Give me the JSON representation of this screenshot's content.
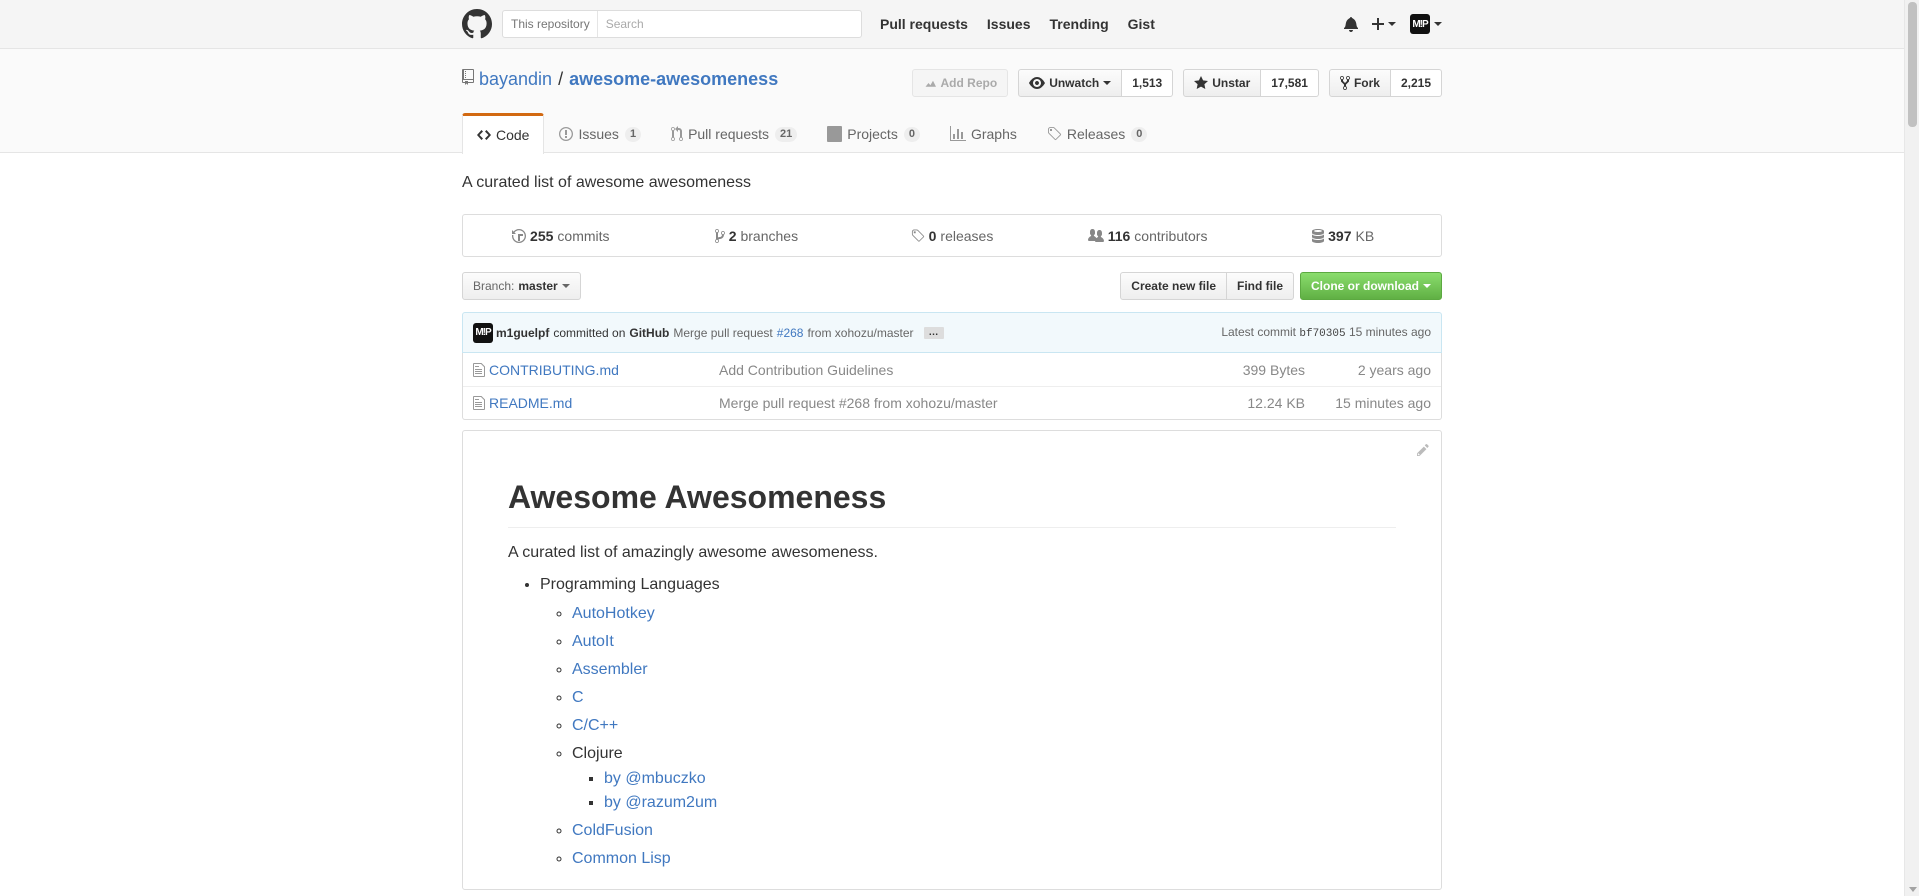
{
  "header": {
    "scope_label": "This repository",
    "search_placeholder": "Search",
    "nav": [
      "Pull requests",
      "Issues",
      "Trending",
      "Gist"
    ],
    "avatar_initials": "M!P"
  },
  "repo": {
    "owner": "bayandin",
    "separator": "/",
    "name": "awesome-awesomeness",
    "actions": {
      "add_repo": "Add Repo",
      "unwatch": "Unwatch",
      "watch_count": "1,513",
      "unstar": "Unstar",
      "star_count": "17,581",
      "fork": "Fork",
      "fork_count": "2,215"
    },
    "tabs": [
      {
        "label": "Code",
        "count": null
      },
      {
        "label": "Issues",
        "count": "1"
      },
      {
        "label": "Pull requests",
        "count": "21"
      },
      {
        "label": "Projects",
        "count": "0"
      },
      {
        "label": "Graphs",
        "count": null
      },
      {
        "label": "Releases",
        "count": "0"
      }
    ],
    "description": "A curated list of awesome awesomeness"
  },
  "summary": {
    "commits": {
      "num": "255",
      "label": "commits"
    },
    "branches": {
      "num": "2",
      "label": "branches"
    },
    "releases": {
      "num": "0",
      "label": "releases"
    },
    "contributors": {
      "num": "116",
      "label": "contributors"
    },
    "size": {
      "num": "397",
      "label": "KB"
    }
  },
  "file_nav": {
    "branch_prefix": "Branch:",
    "branch": "master",
    "create_new_file": "Create new file",
    "find_file": "Find file",
    "clone": "Clone or download"
  },
  "commit": {
    "author": "m1guelpf",
    "committed_on": "committed on",
    "committer": "GitHub",
    "message_prefix": "Merge pull request",
    "pr": "#268",
    "message_suffix": "from xohozu/master",
    "ellipsis": "…",
    "latest_label": "Latest commit",
    "sha": "bf70305",
    "age": "15 minutes ago"
  },
  "files": [
    {
      "name": "CONTRIBUTING.md",
      "message": "Add Contribution Guidelines",
      "size": "399 Bytes",
      "age": "2 years ago"
    },
    {
      "name": "README.md",
      "message": "Merge pull request #268 from xohozu/master",
      "size": "12.24 KB",
      "age": "15 minutes ago"
    }
  ],
  "readme": {
    "title": "Awesome Awesomeness",
    "intro": "A curated list of amazingly awesome awesomeness.",
    "section": "Programming Languages",
    "languages": [
      "AutoHotkey",
      "AutoIt",
      "Assembler",
      "C",
      "C/C++"
    ],
    "clojure": {
      "label": "Clojure",
      "links": [
        "by @mbuczko",
        "by @razum2um"
      ]
    },
    "languages_after": [
      "ColdFusion",
      "Common Lisp"
    ]
  },
  "colors": {
    "link": "#4078c0",
    "tab_accent": "#d26911",
    "primary_button": "#60b044",
    "commit_bar_bg": "#f2f9fc"
  }
}
